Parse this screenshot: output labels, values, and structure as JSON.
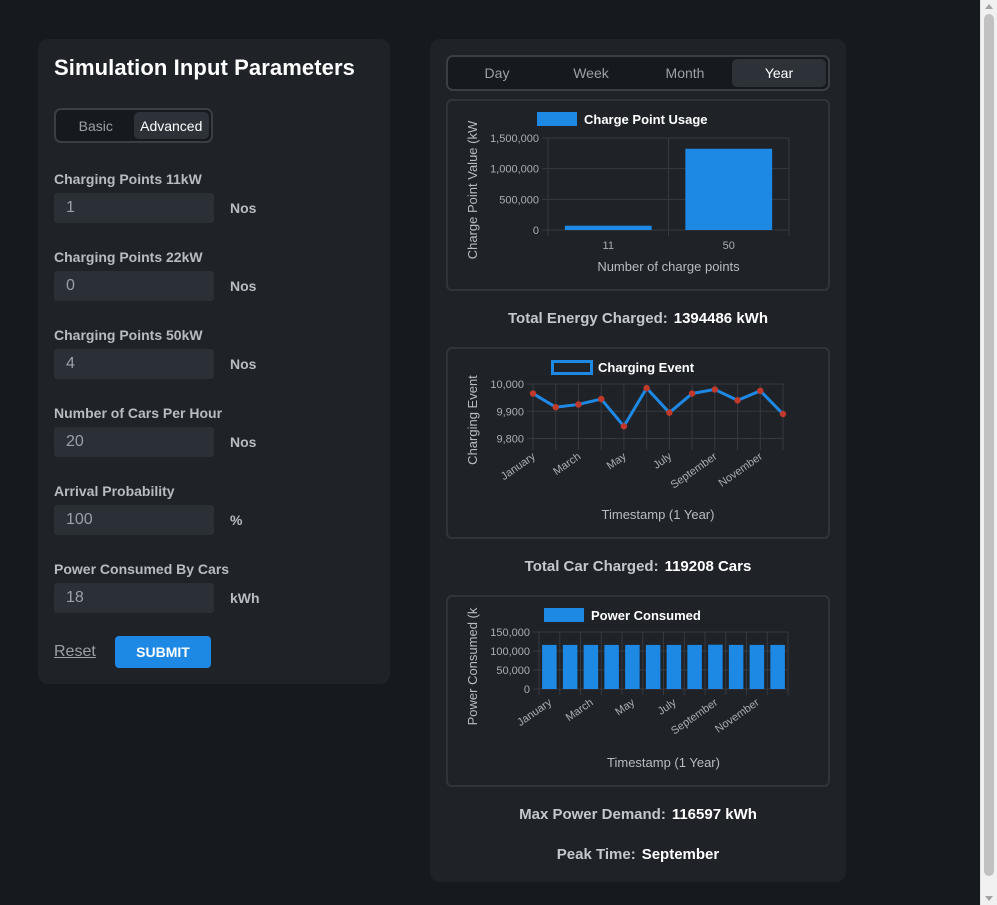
{
  "left": {
    "title": "Simulation Input Parameters",
    "modes": [
      {
        "label": "Basic",
        "active": false
      },
      {
        "label": "Advanced",
        "active": true
      }
    ],
    "fields": [
      {
        "label": "Charging Points 11kW",
        "value": "1",
        "unit": "Nos"
      },
      {
        "label": "Charging Points 22kW",
        "value": "0",
        "unit": "Nos"
      },
      {
        "label": "Charging Points 50kW",
        "value": "4",
        "unit": "Nos"
      },
      {
        "label": "Number of Cars Per Hour",
        "value": "20",
        "unit": "Nos"
      },
      {
        "label": "Arrival Probability",
        "value": "100",
        "unit": "%"
      },
      {
        "label": "Power Consumed By Cars",
        "value": "18",
        "unit": "kWh"
      }
    ],
    "reset_label": "Reset",
    "submit_label": "SUBMIT"
  },
  "right": {
    "tabs": [
      {
        "label": "Day",
        "active": false
      },
      {
        "label": "Week",
        "active": false
      },
      {
        "label": "Month",
        "active": false
      },
      {
        "label": "Year",
        "active": true
      }
    ],
    "summaries": [
      {
        "label": "Total Energy Charged:",
        "value": "1394486 kWh"
      },
      {
        "label": "Total Car Charged:",
        "value": "119208 Cars"
      },
      {
        "label": "Max Power Demand:",
        "value": "116597 kWh"
      },
      {
        "label": "Peak Time:",
        "value": "September"
      }
    ]
  },
  "colors": {
    "accent": "#1e88e5",
    "point": "#c0392b"
  },
  "chart_data": [
    {
      "type": "bar",
      "legend": "Charge Point Usage",
      "xlabel": "Number of charge points",
      "ylabel": "Charge Point Value (kW",
      "categories": [
        "11",
        "50"
      ],
      "values": [
        70000,
        1324486
      ],
      "ylim": [
        0,
        1500000
      ],
      "yticks": [
        "1,500,000",
        "1,000,000",
        "500,000",
        "0"
      ],
      "grid": true,
      "legend_position": "top"
    },
    {
      "type": "line",
      "legend": "Charging Event",
      "xlabel": "Timestamp (1 Year)",
      "ylabel": "Charging Event",
      "x": [
        "January",
        "February",
        "March",
        "April",
        "May",
        "June",
        "July",
        "August",
        "September",
        "October",
        "November",
        "December"
      ],
      "xticks": [
        "January",
        "March",
        "May",
        "July",
        "September",
        "November"
      ],
      "values": [
        9965,
        9915,
        9925,
        9945,
        9845,
        9985,
        9895,
        9965,
        9980,
        9940,
        9975,
        9890
      ],
      "ylim": [
        9780,
        10000
      ],
      "yticks": [
        "10,000",
        "9,900",
        "9,800"
      ],
      "grid": true,
      "legend_position": "top"
    },
    {
      "type": "bar",
      "legend": "Power Consumed",
      "xlabel": "Timestamp (1 Year)",
      "ylabel": "Power Consumed (k",
      "x": [
        "January",
        "February",
        "March",
        "April",
        "May",
        "June",
        "July",
        "August",
        "September",
        "October",
        "November",
        "December"
      ],
      "xticks": [
        "January",
        "March",
        "May",
        "July",
        "September",
        "November"
      ],
      "values": [
        116000,
        116000,
        116000,
        116000,
        116000,
        116000,
        116000,
        116000,
        116597,
        116000,
        116000,
        116000
      ],
      "ylim": [
        0,
        150000
      ],
      "yticks": [
        "150,000",
        "100,000",
        "50,000",
        "0"
      ],
      "grid": true,
      "legend_position": "top"
    }
  ]
}
